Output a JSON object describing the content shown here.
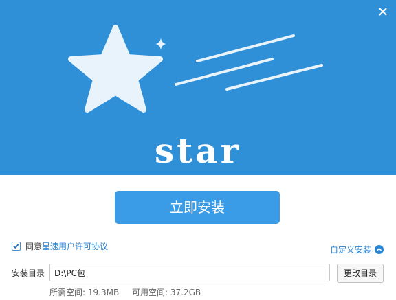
{
  "banner": {
    "brand": "star",
    "background_color": "#2f90d8"
  },
  "window": {
    "close_icon": "close-icon"
  },
  "install": {
    "button_label": "立即安装",
    "button_color": "#3a9be6"
  },
  "agreement": {
    "checked": true,
    "prefix": "同意",
    "link": "星速用户许可协议"
  },
  "custom_install": {
    "label": "自定义安装",
    "icon": "chevron-up-icon"
  },
  "path": {
    "label": "安装目录",
    "value": "D:\\PC包",
    "browse_label": "更改目录"
  },
  "space": {
    "required_label": "所需空间:",
    "required_value": "19.3MB",
    "available_label": "可用空间:",
    "available_value": "37.2GB"
  }
}
